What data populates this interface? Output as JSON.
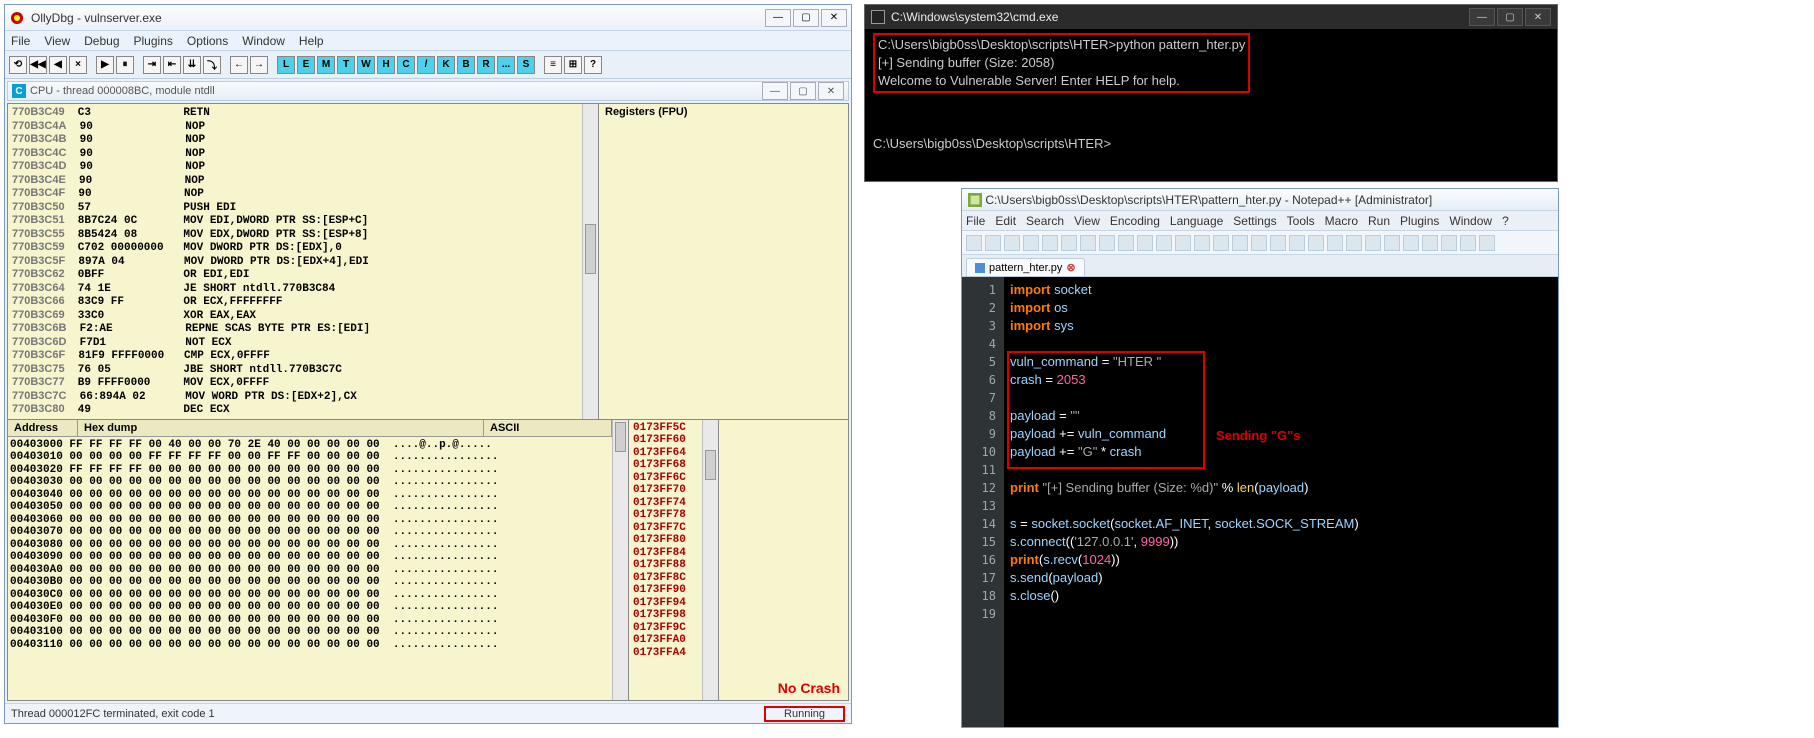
{
  "olly": {
    "title": "OllyDbg - vulnserver.exe",
    "menus": [
      "File",
      "View",
      "Debug",
      "Plugins",
      "Options",
      "Window",
      "Help"
    ],
    "toolbar_glyphs": [
      "⟲",
      "◀◀",
      "◀",
      "×",
      "",
      "▶",
      "⏸",
      "",
      "⇥",
      "⇤",
      "⇊",
      "⤵",
      "",
      "←",
      "→",
      "",
      "L",
      "E",
      "M",
      "T",
      "W",
      "H",
      "C",
      "/",
      "K",
      "B",
      "R",
      "...",
      "S",
      "",
      "≡",
      "⊞",
      "?"
    ],
    "cpu_title": "CPU - thread 000008BC, module ntdll",
    "regs_title": "Registers (FPU)",
    "disasm_lines": [
      [
        "770B3C49",
        "C3",
        "RETN"
      ],
      [
        "770B3C4A",
        "90",
        "NOP"
      ],
      [
        "770B3C4B",
        "90",
        "NOP"
      ],
      [
        "770B3C4C",
        "90",
        "NOP"
      ],
      [
        "770B3C4D",
        "90",
        "NOP"
      ],
      [
        "770B3C4E",
        "90",
        "NOP"
      ],
      [
        "770B3C4F",
        "90",
        "NOP"
      ],
      [
        "770B3C50",
        "57",
        "PUSH EDI"
      ],
      [
        "770B3C51",
        "8B7C24 0C",
        "MOV EDI,DWORD PTR SS:[ESP+C]"
      ],
      [
        "770B3C55",
        "8B5424 08",
        "MOV EDX,DWORD PTR SS:[ESP+8]"
      ],
      [
        "770B3C59",
        "C702 00000000",
        "MOV DWORD PTR DS:[EDX],0"
      ],
      [
        "770B3C5F",
        "897A 04",
        "MOV DWORD PTR DS:[EDX+4],EDI"
      ],
      [
        "770B3C62",
        "0BFF",
        "OR EDI,EDI"
      ],
      [
        "770B3C64",
        "74 1E",
        "JE SHORT ntdll.770B3C84"
      ],
      [
        "770B3C66",
        "83C9 FF",
        "OR ECX,FFFFFFFF"
      ],
      [
        "770B3C69",
        "33C0",
        "XOR EAX,EAX"
      ],
      [
        "770B3C6B",
        "F2:AE",
        "REPNE SCAS BYTE PTR ES:[EDI]"
      ],
      [
        "770B3C6D",
        "F7D1",
        "NOT ECX"
      ],
      [
        "770B3C6F",
        "81F9 FFFF0000",
        "CMP ECX,0FFFF"
      ],
      [
        "770B3C75",
        "76 05",
        "JBE SHORT ntdll.770B3C7C"
      ],
      [
        "770B3C77",
        "B9 FFFF0000",
        "MOV ECX,0FFFF"
      ],
      [
        "770B3C7C",
        "66:894A 02",
        "MOV WORD PTR DS:[EDX+2],CX"
      ],
      [
        "770B3C80",
        "49",
        "DEC ECX"
      ]
    ],
    "dump_hdr": [
      "Address",
      "Hex dump",
      "ASCII"
    ],
    "dump_lines": [
      "00403000 FF FF FF FF 00 40 00 00 70 2E 40 00 00 00 00 00  ....@..p.@.....",
      "00403010 00 00 00 00 FF FF FF FF 00 00 FF FF 00 00 00 00  ................",
      "00403020 FF FF FF FF 00 00 00 00 00 00 00 00 00 00 00 00  ................",
      "00403030 00 00 00 00 00 00 00 00 00 00 00 00 00 00 00 00  ................",
      "00403040 00 00 00 00 00 00 00 00 00 00 00 00 00 00 00 00  ................",
      "00403050 00 00 00 00 00 00 00 00 00 00 00 00 00 00 00 00  ................",
      "00403060 00 00 00 00 00 00 00 00 00 00 00 00 00 00 00 00  ................",
      "00403070 00 00 00 00 00 00 00 00 00 00 00 00 00 00 00 00  ................",
      "00403080 00 00 00 00 00 00 00 00 00 00 00 00 00 00 00 00  ................",
      "00403090 00 00 00 00 00 00 00 00 00 00 00 00 00 00 00 00  ................",
      "004030A0 00 00 00 00 00 00 00 00 00 00 00 00 00 00 00 00  ................",
      "004030B0 00 00 00 00 00 00 00 00 00 00 00 00 00 00 00 00  ................",
      "004030C0 00 00 00 00 00 00 00 00 00 00 00 00 00 00 00 00  ................",
      "004030E0 00 00 00 00 00 00 00 00 00 00 00 00 00 00 00 00  ................",
      "004030F0 00 00 00 00 00 00 00 00 00 00 00 00 00 00 00 00  ................",
      "00403100 00 00 00 00 00 00 00 00 00 00 00 00 00 00 00 00  ................",
      "00403110 00 00 00 00 00 00 00 00 00 00 00 00 00 00 00 00  ................"
    ],
    "stack_addrs": [
      "0173FF5C",
      "0173FF60",
      "0173FF64",
      "0173FF68",
      "0173FF6C",
      "0173FF70",
      "0173FF74",
      "0173FF78",
      "0173FF7C",
      "0173FF80",
      "0173FF84",
      "0173FF88",
      "0173FF8C",
      "0173FF90",
      "0173FF94",
      "0173FF98",
      "0173FF9C",
      "0173FFA0",
      "0173FFA4"
    ],
    "no_crash": "No Crash",
    "status_left": "Thread 000012FC terminated, exit code 1",
    "status_right": "Running"
  },
  "cmd": {
    "title": "C:\\Windows\\system32\\cmd.exe",
    "lines": [
      "C:\\Users\\bigb0ss\\Desktop\\scripts\\HTER>python pattern_hter.py",
      "[+] Sending buffer (Size: 2058)",
      "Welcome to Vulnerable Server! Enter HELP for help."
    ],
    "prompt2": "C:\\Users\\bigb0ss\\Desktop\\scripts\\HTER>"
  },
  "npp": {
    "title": "C:\\Users\\bigb0ss\\Desktop\\scripts\\HTER\\pattern_hter.py - Notepad++ [Administrator]",
    "menus": [
      "File",
      "Edit",
      "Search",
      "View",
      "Encoding",
      "Language",
      "Settings",
      "Tools",
      "Macro",
      "Run",
      "Plugins",
      "Window",
      "?"
    ],
    "tab": "pattern_hter.py",
    "annot": "Sending \"G\"s",
    "code": {
      "l1_kw": "import",
      "l1_v": "socket",
      "l2_kw": "import",
      "l2_v": "os",
      "l3_kw": "import",
      "l3_v": "sys",
      "l5_v": "vuln_command",
      "l5_s": "\"HTER \"",
      "l6_v": "crash",
      "l6_n": "2053",
      "l8_v": "payload",
      "l8_s": "\"\"",
      "l9_a": "payload",
      "l9_b": "vuln_command",
      "l10_a": "payload",
      "l10_s": "\"G\"",
      "l10_b": "crash",
      "l12_p": "print",
      "l12_s": "\"[+] Sending buffer (Size: %d)\"",
      "l12_len": "len",
      "l12_arg": "payload",
      "l14_s": "s",
      "l14_sock": "socket.socket",
      "l14_af": "socket.AF_INET",
      "l14_st": "socket.SOCK_STREAM",
      "l15_c": "s.connect",
      "l15_ip": "'127.0.0.1'",
      "l15_port": "9999",
      "l16_p": "print",
      "l16_r": "s.recv",
      "l16_n": "1024",
      "l17_s": "s.send",
      "l17_a": "payload",
      "l18_c": "s.close"
    }
  }
}
